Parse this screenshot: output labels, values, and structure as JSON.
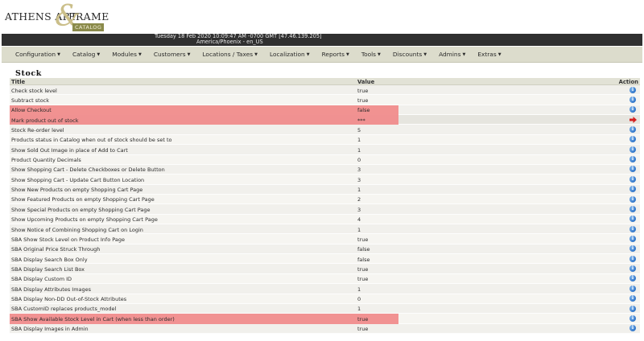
{
  "logo": {
    "part1": "ATHENS ART",
    "amp": "&",
    "part2": "FRAME",
    "badge": "CATALOG"
  },
  "header": {
    "datetime": "Tuesday 18 Feb 2020 10:09:47 AM -0700 GMT [47.46.139.205]",
    "timezone": "America/Phoenix - en_US"
  },
  "nav": {
    "items": [
      {
        "label": "Configuration"
      },
      {
        "label": "Catalog"
      },
      {
        "label": "Modules"
      },
      {
        "label": "Customers"
      },
      {
        "label": "Locations / Taxes"
      },
      {
        "label": "Localization"
      },
      {
        "label": "Reports"
      },
      {
        "label": "Tools"
      },
      {
        "label": "Discounts"
      },
      {
        "label": "Admins"
      },
      {
        "label": "Extras"
      }
    ]
  },
  "page": {
    "title": "Stock"
  },
  "table": {
    "headers": {
      "title": "Title",
      "value": "Value",
      "action": "Action"
    },
    "rows": [
      {
        "title": "Check stock level",
        "value": "true",
        "highlight": false,
        "selected": false
      },
      {
        "title": "Subtract stock",
        "value": "true",
        "highlight": false,
        "selected": false
      },
      {
        "title": "Allow Checkout",
        "value": "false",
        "highlight": true,
        "selected": false
      },
      {
        "title": "Mark product out of stock",
        "value": "***",
        "highlight": true,
        "selected": true
      },
      {
        "title": "Stock Re-order level",
        "value": "5",
        "highlight": false,
        "selected": false
      },
      {
        "title": "Products status in Catalog when out of stock should be set to",
        "value": "1",
        "highlight": false,
        "selected": false
      },
      {
        "title": "Show Sold Out Image in place of Add to Cart",
        "value": "1",
        "highlight": false,
        "selected": false
      },
      {
        "title": "Product Quantity Decimals",
        "value": "0",
        "highlight": false,
        "selected": false
      },
      {
        "title": "Show Shopping Cart - Delete Checkboxes or Delete Button",
        "value": "3",
        "highlight": false,
        "selected": false
      },
      {
        "title": "Show Shopping Cart - Update Cart Button Location",
        "value": "3",
        "highlight": false,
        "selected": false
      },
      {
        "title": "Show New Products on empty Shopping Cart Page",
        "value": "1",
        "highlight": false,
        "selected": false
      },
      {
        "title": "Show Featured Products on empty Shopping Cart Page",
        "value": "2",
        "highlight": false,
        "selected": false
      },
      {
        "title": "Show Special Products on empty Shopping Cart Page",
        "value": "3",
        "highlight": false,
        "selected": false
      },
      {
        "title": "Show Upcoming Products on empty Shopping Cart Page",
        "value": "4",
        "highlight": false,
        "selected": false
      },
      {
        "title": "Show Notice of Combining Shopping Cart on Login",
        "value": "1",
        "highlight": false,
        "selected": false
      },
      {
        "title": "SBA Show Stock Level on Product Info Page",
        "value": "true",
        "highlight": false,
        "selected": false
      },
      {
        "title": "SBA Original Price Struck Through",
        "value": "false",
        "highlight": false,
        "selected": false
      },
      {
        "title": "SBA Display Search Box Only",
        "value": "false",
        "highlight": false,
        "selected": false
      },
      {
        "title": "SBA Display Search List Box",
        "value": "true",
        "highlight": false,
        "selected": false
      },
      {
        "title": "SBA Display Custom ID",
        "value": "true",
        "highlight": false,
        "selected": false
      },
      {
        "title": "SBA Display Attributes Images",
        "value": "1",
        "highlight": false,
        "selected": false
      },
      {
        "title": "SBA Display Non-DD Out-of-Stock Attributes",
        "value": "0",
        "highlight": false,
        "selected": false
      },
      {
        "title": "SBA CustomID replaces products_model",
        "value": "1",
        "highlight": false,
        "selected": false
      },
      {
        "title": "SBA Show Available Stock Level in Cart (when less than order)",
        "value": "true",
        "highlight": true,
        "selected": false
      },
      {
        "title": "SBA Display Images in Admin",
        "value": "true",
        "highlight": false,
        "selected": false
      }
    ]
  },
  "colors": {
    "highlight": "#f08c8c",
    "info_icon": "#2f74c8",
    "arrow_icon": "#d42020",
    "header_bar": "#303030",
    "nav_bg": "#dcdccc"
  },
  "icons": {
    "row_action": "info-icon",
    "selected_action": "arrow-right-icon"
  }
}
